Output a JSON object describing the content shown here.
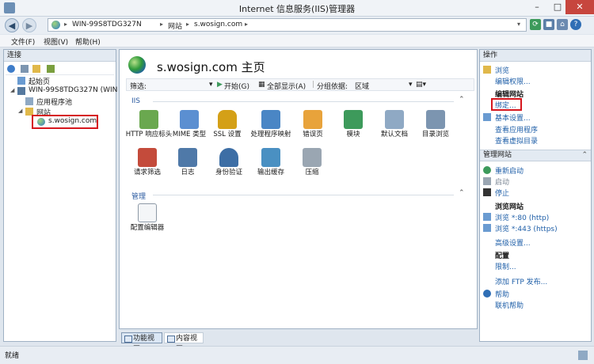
{
  "window": {
    "title": "Internet 信息服务(IIS)管理器",
    "minimize": "–",
    "maximize": "□",
    "close": "✕"
  },
  "address": {
    "crumbs": [
      "WIN-99S8TDG327N",
      "网站",
      "s.wosign.com"
    ]
  },
  "menu": [
    "文件(F)",
    "视图(V)",
    "帮助(H)"
  ],
  "connections": {
    "header": "连接",
    "items": [
      {
        "label": "起始页"
      },
      {
        "label": "WIN-99S8TDG327N (WIN"
      },
      {
        "label": "应用程序池"
      },
      {
        "label": "网站"
      },
      {
        "label": "s.wosign.com"
      }
    ]
  },
  "main": {
    "title": "s.wosign.com 主页",
    "filter_label": "筛选:",
    "go_label": "开始(G)",
    "show_all_label": "全部显示(A)",
    "group_label": "分组依据:",
    "group_value": "区域",
    "sections": [
      {
        "name": "IIS",
        "features": [
          {
            "label": "HTTP 响应标头",
            "icon": "http-response-headers-icon",
            "color": "#6aa84f"
          },
          {
            "label": "MIME 类型",
            "icon": "mime-types-icon",
            "color": "#5b8fd1"
          },
          {
            "label": "SSL 设置",
            "icon": "ssl-lock-icon",
            "color": "#d4a017"
          },
          {
            "label": "处理程序映射",
            "icon": "handler-mappings-icon",
            "color": "#4a86c5"
          },
          {
            "label": "错误页",
            "icon": "error-pages-icon",
            "color": "#e8a33b"
          },
          {
            "label": "模块",
            "icon": "modules-icon",
            "color": "#3d9a5b"
          },
          {
            "label": "默认文档",
            "icon": "default-document-icon",
            "color": "#8fa9c4"
          },
          {
            "label": "目录浏览",
            "icon": "directory-browsing-icon",
            "color": "#7c95b0"
          },
          {
            "label": "请求筛选",
            "icon": "request-filtering-icon",
            "color": "#c44b3b"
          },
          {
            "label": "日志",
            "icon": "logging-icon",
            "color": "#4f79a8"
          },
          {
            "label": "身份验证",
            "icon": "authentication-icon",
            "color": "#3d6ea5"
          },
          {
            "label": "输出缓存",
            "icon": "output-caching-icon",
            "color": "#4a90c2"
          },
          {
            "label": "压缩",
            "icon": "compression-icon",
            "color": "#9aa6b2"
          }
        ]
      },
      {
        "name": "管理",
        "features": [
          {
            "label": "配置编辑器",
            "icon": "configuration-editor-icon",
            "color": "#9aa6b2"
          }
        ]
      }
    ],
    "view_tabs": [
      "功能视图",
      "内容视图"
    ]
  },
  "actions": {
    "header": "操作",
    "top": [
      {
        "label": "浏览",
        "icon": "explore-icon"
      },
      {
        "label": "编辑权限..."
      }
    ],
    "edit_site_title": "编辑网站",
    "edit_site": [
      "绑定...",
      "基本设置...",
      "查看应用程序",
      "查看虚拟目录"
    ],
    "manage_site_group": "管理网站",
    "manage": [
      {
        "label": "重新启动",
        "icon": "restart-icon"
      },
      {
        "label": "启动",
        "icon": "start-icon"
      },
      {
        "label": "停止",
        "icon": "stop-icon"
      }
    ],
    "browse_site_title": "浏览网站",
    "browse": [
      "浏览 *:80 (http)",
      "浏览 *:443 (https)"
    ],
    "more": [
      "高级设置..."
    ],
    "config_title": "配置",
    "config": [
      "限制..."
    ],
    "ftp": "添加 FTP 发布...",
    "help": "帮助",
    "online_help": "联机帮助"
  },
  "status": "就绪"
}
